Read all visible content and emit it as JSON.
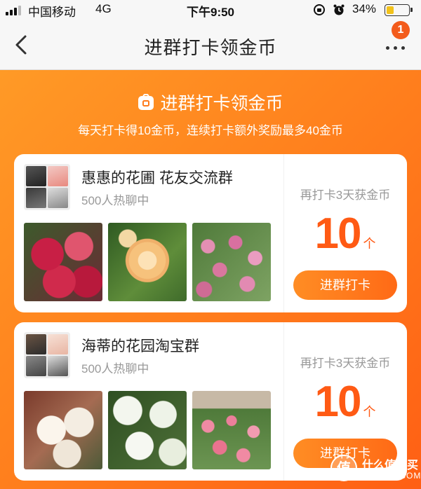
{
  "status_bar": {
    "carrier": "中国移动",
    "network": "4G",
    "time": "下午9:50",
    "battery_percent": "34%",
    "battery_level": 0.34
  },
  "nav": {
    "title": "进群打卡领金币",
    "badge_count": "1",
    "back_icon": "chevron-left-icon",
    "more_icon": "more-dots-icon"
  },
  "banner": {
    "title": "进群打卡领金币",
    "subtitle": "每天打卡得10金币，连续打卡额外奖励最多40金币",
    "icon": "coin-bag-icon",
    "gradient": [
      "#ff9a26",
      "#ff5f14"
    ]
  },
  "groups": [
    {
      "name": "惠惠的花圃   花友交流群",
      "members": "500人热聊中",
      "hint": "再打卡3天获金币",
      "reward": "10",
      "unit": "个",
      "button": "进群打卡"
    },
    {
      "name": "海蒂的花园淘宝群",
      "members": "500人热聊中",
      "hint": "再打卡3天获金币",
      "reward": "10",
      "unit": "个",
      "button": "进群打卡"
    }
  ],
  "watermark": {
    "cn": "什么值得买",
    "en": "SMZDM.COM"
  },
  "colors": {
    "accent": "#ff5a14",
    "button": "#ff7c1c",
    "badge": "#f35b1b"
  }
}
